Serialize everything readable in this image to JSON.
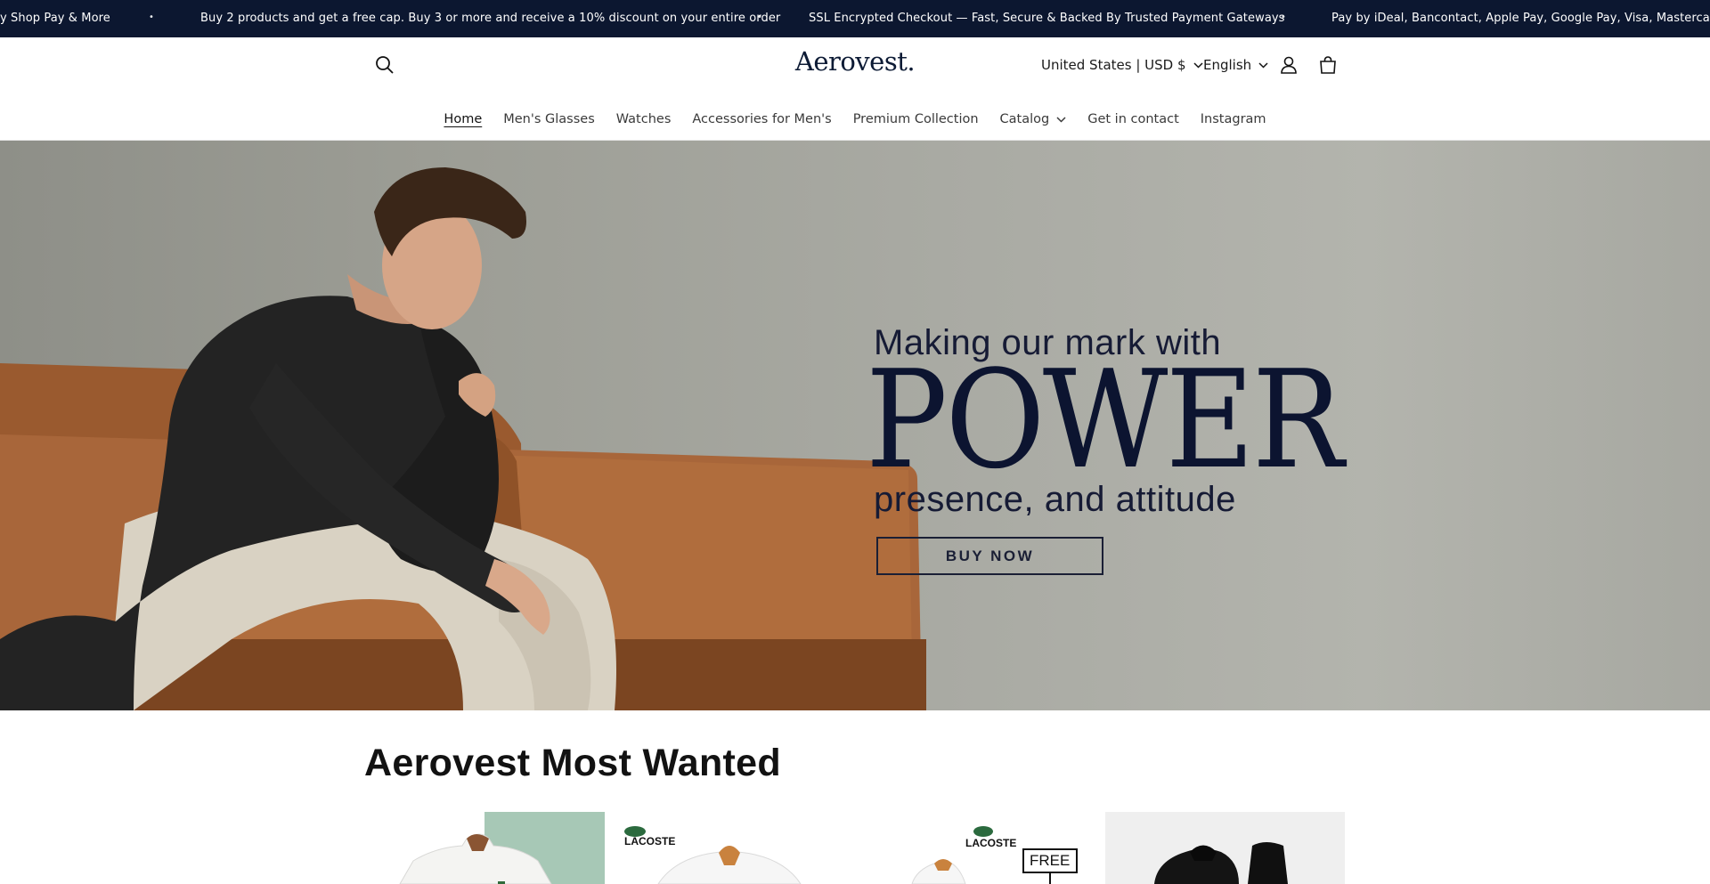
{
  "announcement": {
    "items": [
      "y Shop Pay & More",
      "Buy 2 products and get a free cap. Buy 3 or more and receive a 10% discount on your entire order",
      "SSL Encrypted Checkout — Fast, Secure & Backed By Trusted Payment Gateways",
      "Pay by iDeal, Bancontact, Apple Pay, Google Pay, Visa, Mastercard, Ame"
    ],
    "separator": "•"
  },
  "header": {
    "logo": "Aerovest.",
    "country": "United States | USD $",
    "language": "English",
    "icons": [
      "search-icon",
      "account-icon",
      "cart-icon",
      "chevron-down-icon"
    ]
  },
  "nav": {
    "items": [
      {
        "label": "Home"
      },
      {
        "label": "Men's Glasses"
      },
      {
        "label": "Watches"
      },
      {
        "label": "Accessories for Men's"
      },
      {
        "label": "Premium Collection"
      },
      {
        "label": "Catalog"
      },
      {
        "label": "Get in contact"
      },
      {
        "label": "Instagram"
      }
    ]
  },
  "hero": {
    "tagline": "Making our mark with",
    "headline": "POWER",
    "subline": "presence, and attitude",
    "cta": "BUY NOW"
  },
  "section": {
    "title": "Aerovest Most Wanted",
    "products": [
      {
        "brand_text": "",
        "badge": ""
      },
      {
        "brand_text": "LACOSTE",
        "badge": ""
      },
      {
        "brand_text": "LACOSTE",
        "badge": "FREE"
      },
      {
        "brand_text": "",
        "badge": ""
      }
    ]
  },
  "colors": {
    "announcement_bg": "#0c1730",
    "brand_navy": "#0d1b35",
    "hero_text": "#161b35"
  }
}
